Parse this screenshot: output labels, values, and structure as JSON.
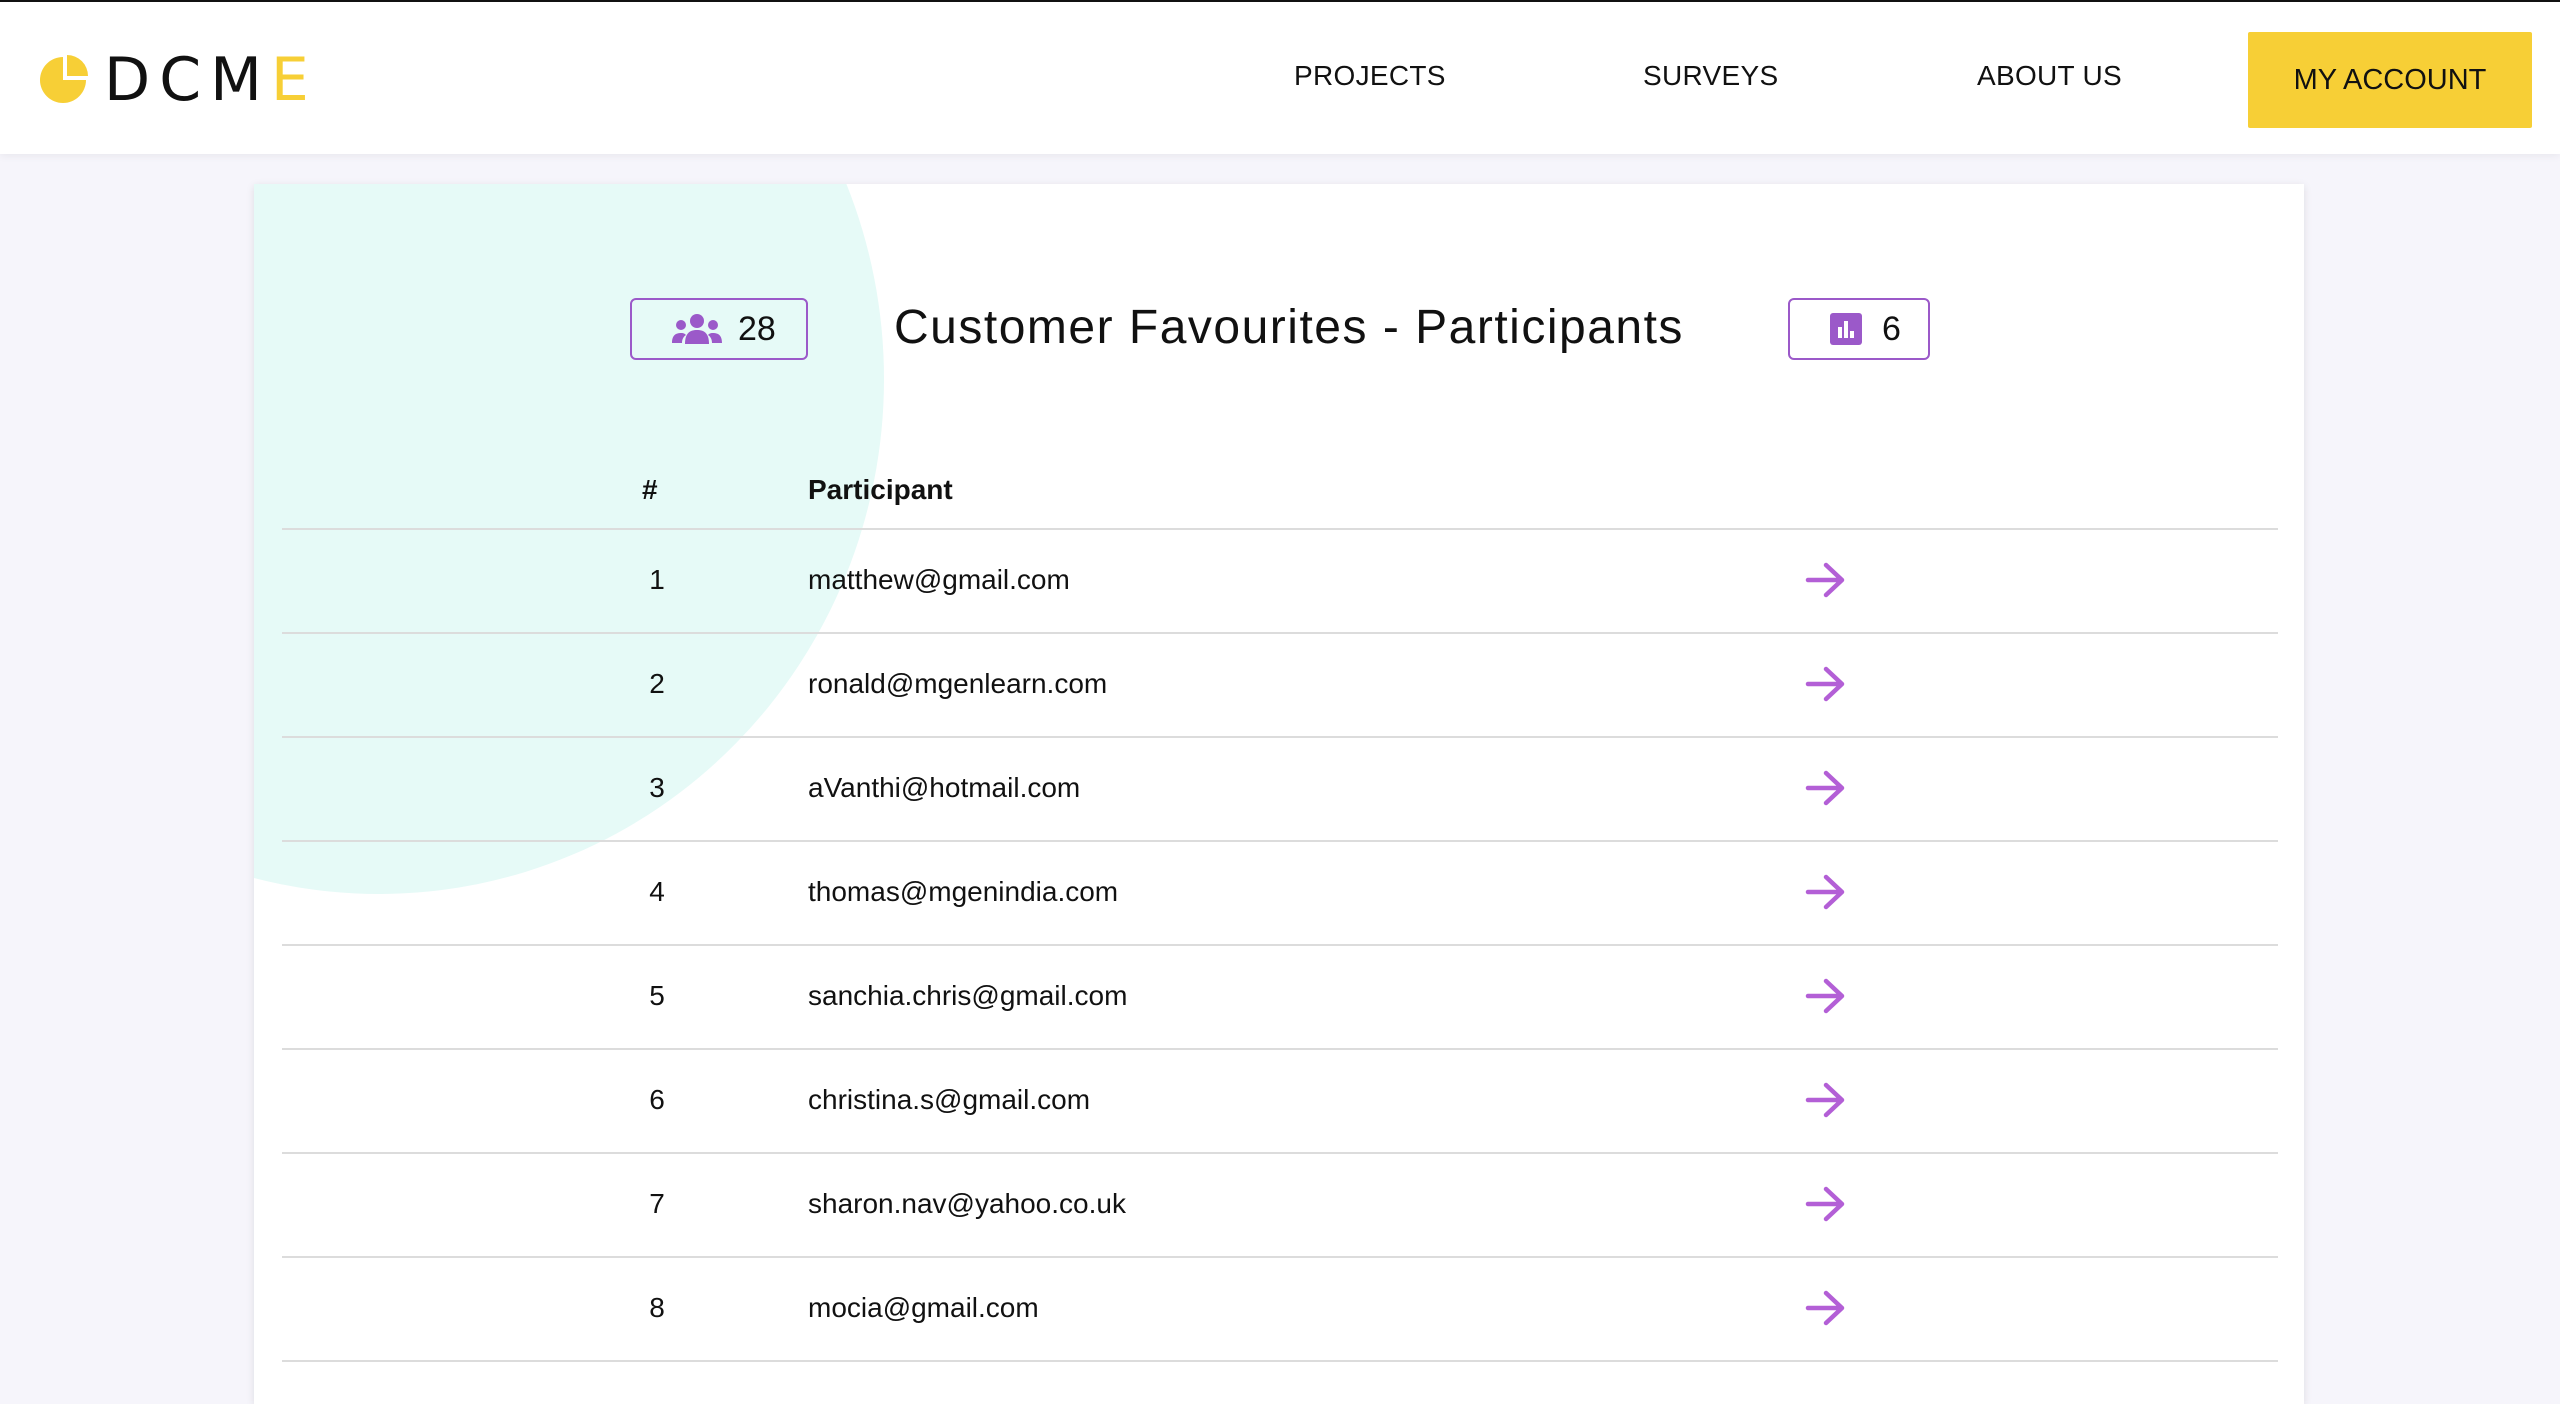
{
  "header": {
    "logo_letters_main": "DCM",
    "logo_letters_accent": "E",
    "nav": {
      "projects": "PROJECTS",
      "surveys": "SURVEYS",
      "about": "ABOUT US"
    },
    "account_button": "MY ACCOUNT"
  },
  "summary": {
    "title": "Customer Favourites - Participants",
    "participant_count": "28",
    "response_count": "6"
  },
  "table": {
    "columns": {
      "number": "#",
      "participant": "Participant"
    },
    "rows": [
      {
        "number": "1",
        "email": "matthew@gmail.com"
      },
      {
        "number": "2",
        "email": "ronald@mgenlearn.com"
      },
      {
        "number": "3",
        "email": "aVanthi@hotmail.com"
      },
      {
        "number": "4",
        "email": "thomas@mgenindia.com"
      },
      {
        "number": "5",
        "email": "sanchia.chris@gmail.com"
      },
      {
        "number": "6",
        "email": "christina.s@gmail.com"
      },
      {
        "number": "7",
        "email": "sharon.nav@yahoo.co.uk"
      },
      {
        "number": "8",
        "email": "mocia@gmail.com"
      }
    ]
  },
  "icons": {
    "participants": "users-group-icon",
    "responses": "bar-chart-icon",
    "row_action": "arrow-right-icon"
  },
  "colors": {
    "brand_yellow": "#f7cf36",
    "accent_purple": "#9b59c9",
    "background": "#f6f5fb",
    "decor_circle": "#e6faf7"
  }
}
